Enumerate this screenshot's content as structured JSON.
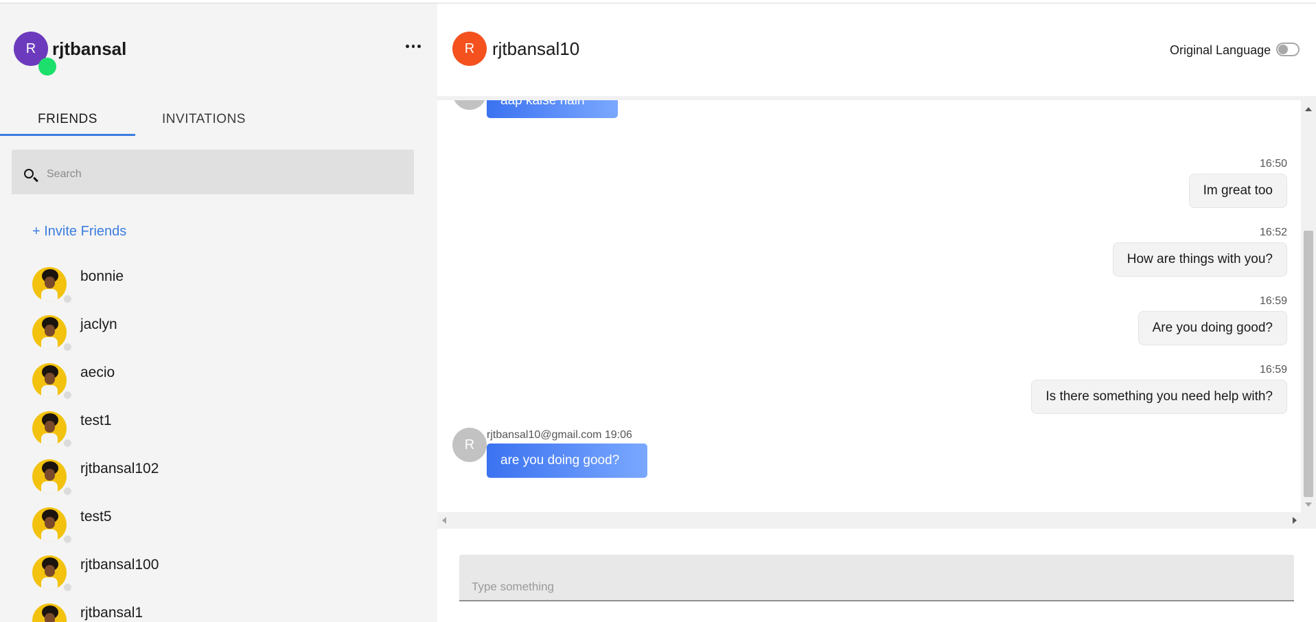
{
  "user": {
    "avatar_initial": "R",
    "name": "rjtbansal",
    "avatar_color": "#6c3bbd",
    "status_color": "#1ce06b"
  },
  "tabs": [
    {
      "label": "FRIENDS",
      "active": true
    },
    {
      "label": "INVITATIONS",
      "active": false
    }
  ],
  "search": {
    "placeholder": "Search",
    "value": ""
  },
  "invite_link": "+ Invite Friends",
  "friends": [
    {
      "name": "bonnie"
    },
    {
      "name": "jaclyn"
    },
    {
      "name": "aecio"
    },
    {
      "name": "test1"
    },
    {
      "name": "rjtbansal102"
    },
    {
      "name": "test5"
    },
    {
      "name": "rjtbansal100"
    },
    {
      "name": "rjtbansal1"
    }
  ],
  "chat": {
    "contact_initial": "R",
    "contact_name": "rjtbansal10",
    "contact_avatar_color": "#f4511e",
    "original_language_label": "Original Language",
    "original_language_on": false,
    "messages": [
      {
        "direction": "in",
        "avatar_initial": "R",
        "text": "aap kaise hain"
      },
      {
        "direction": "out",
        "time": "16:50",
        "text": "Im great too"
      },
      {
        "direction": "out",
        "time": "16:52",
        "text": "How are things with you?"
      },
      {
        "direction": "out",
        "time": "16:59",
        "text": "Are you doing good?"
      },
      {
        "direction": "out",
        "time": "16:59",
        "text": "Is there something you need help with?"
      },
      {
        "direction": "in",
        "avatar_initial": "R",
        "meta": "rjtbansal10@gmail.com 19:06",
        "text": "are you doing good?"
      }
    ],
    "composer_placeholder": "Type something"
  },
  "colors": {
    "accent": "#3b7de0",
    "bubble_gradient_start": "#3b72f0",
    "bubble_gradient_end": "#7aa8ff"
  }
}
